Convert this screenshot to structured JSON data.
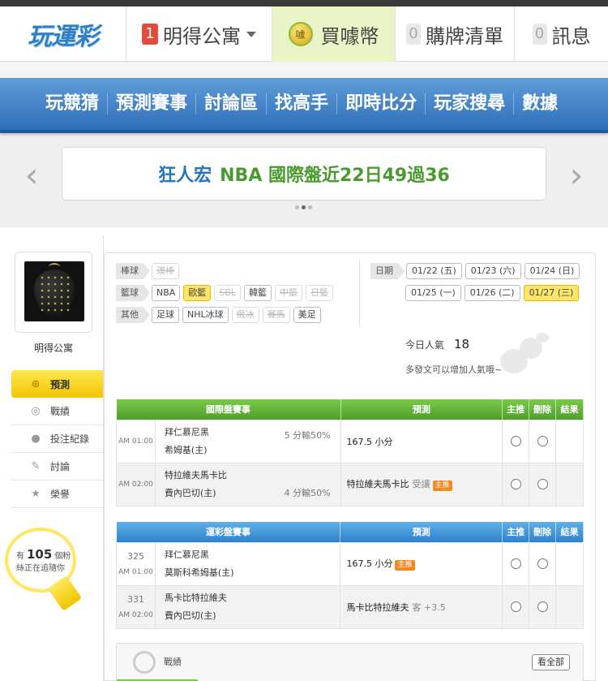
{
  "topbar": {
    "logo": "玩運彩",
    "apartment_badge": "1",
    "apartment_label": "明得公寓",
    "coin_icon_text": "噱",
    "coin_label": "買噱幣",
    "list_badge": "0",
    "list_label": "購牌清單",
    "msg_badge": "0",
    "msg_label": "訊息"
  },
  "nav": {
    "items": [
      "玩競猜",
      "預測賽事",
      "討論區",
      "找高手",
      "即時比分",
      "玩家搜尋",
      "數據"
    ]
  },
  "banner": {
    "author": "狂人宏",
    "text": "NBA 國際盤近22日49過36"
  },
  "sidebar": {
    "username": "明得公寓",
    "items": [
      {
        "label": "預測",
        "icon": "target-icon"
      },
      {
        "label": "戰績",
        "icon": "record-icon"
      },
      {
        "label": "投注紀錄",
        "icon": "circle-icon"
      },
      {
        "label": "討論",
        "icon": "discussion-icon"
      },
      {
        "label": "榮譽",
        "icon": "medal-icon"
      }
    ],
    "follow_prefix": "有",
    "follow_count": "105",
    "follow_unit": "個粉",
    "follow_suffix": "絲正在追隨你"
  },
  "filters": {
    "baseball_label": "棒球",
    "baseball": [
      "澳棒"
    ],
    "basketball_label": "籃球",
    "basketball": [
      "NBA",
      "歐籃",
      "SBL",
      "韓籃",
      "中籃",
      "日籃"
    ],
    "other_label": "其他",
    "other": [
      "足球",
      "NHL冰球",
      "俄冰",
      "賽馬",
      "美足"
    ],
    "date_label": "日期",
    "dates": [
      "01/22 (五)",
      "01/23 (六)",
      "01/24 (日)",
      "01/25 (一)",
      "01/26 (二)",
      "01/27 (三)"
    ]
  },
  "popularity": {
    "label": "今日人氣",
    "value": "18",
    "hint": "多發文可以增加人氣哦~"
  },
  "intl_table": {
    "headers": [
      "國際盤賽事",
      "預測",
      "主推",
      "刪除",
      "結果"
    ],
    "rows": [
      {
        "time": "AM 01:00",
        "away": "拜仁慕尼黑",
        "home": "希姆基(主)",
        "line": "5 分輸50%",
        "pick": "167.5 小分",
        "sub": "",
        "tag": ""
      },
      {
        "time": "AM 02:00",
        "away": "特拉維夫馬卡比",
        "home": "費內巴切(主)",
        "line": "4 分輸50%",
        "pick": "特拉維夫馬卡比",
        "sub": "受讓",
        "tag": "主推"
      }
    ]
  },
  "lottery_table": {
    "headers": [
      "運彩盤賽事",
      "預測",
      "主推",
      "刪除",
      "結果"
    ],
    "rows": [
      {
        "num": "325",
        "time": "AM 01:00",
        "away": "拜仁慕尼黑",
        "home": "莫斯科希姆基(主)",
        "pick": "167.5 小分",
        "sub": "",
        "tag": "主推"
      },
      {
        "num": "331",
        "time": "AM 02:00",
        "away": "馬卡比特拉維夫",
        "home": "費內巴切(主)",
        "pick": "馬卡比特拉維夫",
        "sub": "客 +3.5",
        "tag": ""
      }
    ]
  },
  "record": {
    "title": "戰績",
    "see_all": "看全部"
  },
  "colors": {
    "nav_blue": "#2f6fb8",
    "table_green": "#4f9e2b",
    "table_blue": "#2e82c9",
    "active_yellow": "#f2c400",
    "tag_orange": "#f08a24"
  }
}
